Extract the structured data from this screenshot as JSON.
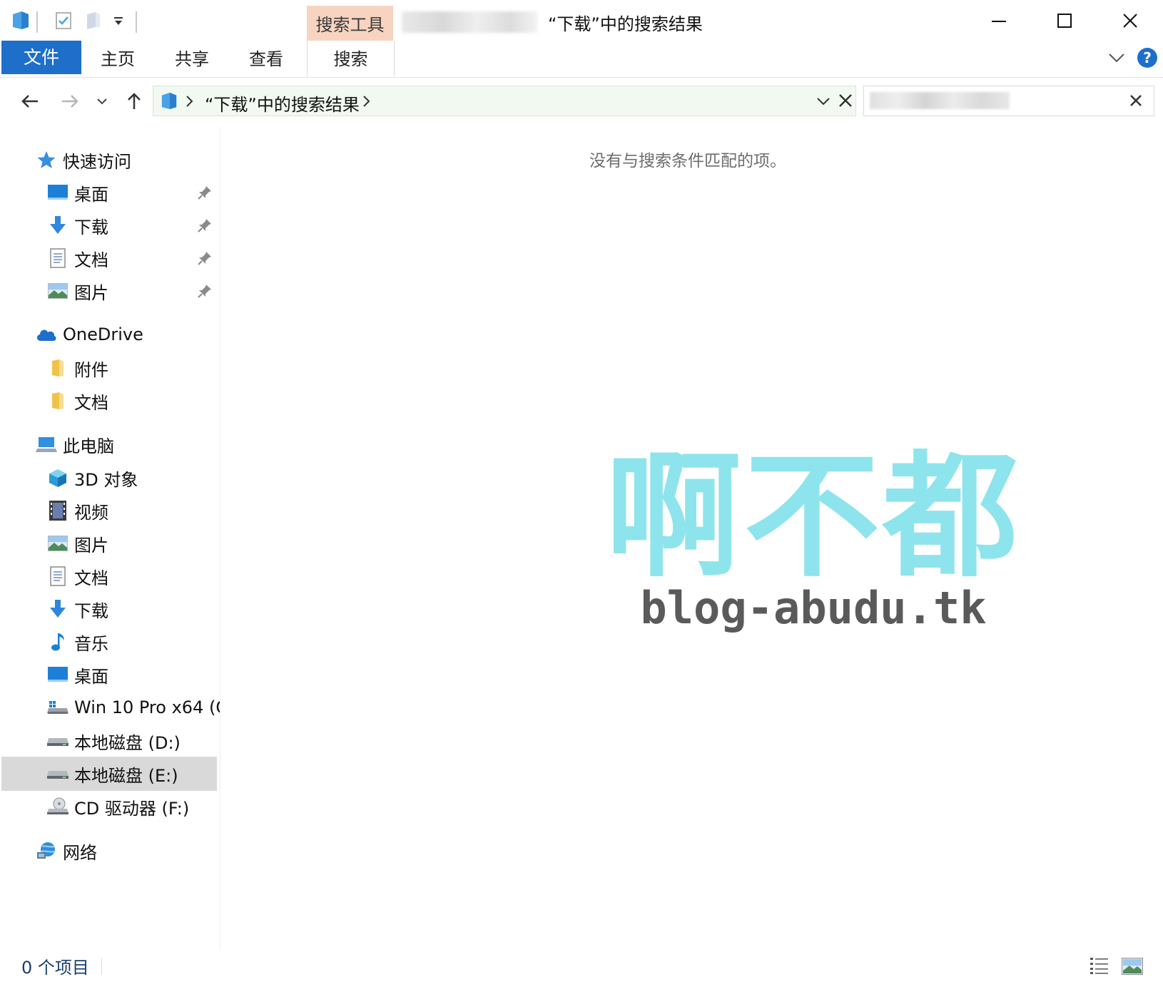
{
  "titlebar": {
    "context_tab_group": "搜索工具",
    "window_title": "“下载”中的搜索结果",
    "qa_icons": [
      "app-icon",
      "properties-icon",
      "new-folder-icon",
      "customize-dropdown-icon"
    ]
  },
  "ribbon": {
    "file_tab": "文件",
    "tabs": [
      "主页",
      "共享",
      "查看"
    ],
    "search_tab": "搜索",
    "help_label": "?"
  },
  "navbar": {
    "address_path": "“下载”中的搜索结果",
    "address_bg_color": "#f1f9f0"
  },
  "sidebar": {
    "quick_access": {
      "label": "快速访问",
      "items": [
        "桌面",
        "下载",
        "文档",
        "图片"
      ]
    },
    "onedrive": {
      "label": "OneDrive",
      "items": [
        "附件",
        "文档"
      ]
    },
    "this_pc": {
      "label": "此电脑",
      "items": [
        "3D 对象",
        "视频",
        "图片",
        "文档",
        "下载",
        "音乐",
        "桌面",
        "Win 10 Pro x64 (C",
        "本地磁盘 (D:)",
        "本地磁盘 (E:)",
        "CD 驱动器 (F:)"
      ],
      "selected": "本地磁盘 (E:)"
    },
    "network": {
      "label": "网络"
    }
  },
  "content": {
    "empty_message": "没有与搜索条件匹配的项。",
    "watermark_title": "啊不都",
    "watermark_url": "blog-abudu.tk"
  },
  "statusbar": {
    "item_count": "0 个项目"
  },
  "colors": {
    "accent": "#1e6fc9",
    "context_tab": "#f7d4c0",
    "watermark_cyan": "#8ee4ec",
    "watermark_gray": "#5a5a5a",
    "selection": "#d9d9d9"
  }
}
